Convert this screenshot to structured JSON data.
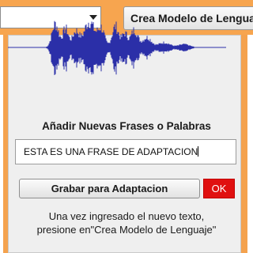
{
  "toolbar": {
    "combo_value": "",
    "build_model_label": "Crea Modelo de Lenguaje"
  },
  "panel": {
    "title": "Añadir Nuevas Frases o Palabras",
    "phrase_value": "ESTA ES UNA FRASE DE ADAPTACION",
    "record_label": "Grabar para Adaptacion",
    "ok_label": "OK",
    "hint_line1": "Una vez ingresado el nuevo texto,",
    "hint_line2": "presione en\"Crea Modelo de Lenguaje\""
  },
  "colors": {
    "accent_orange": "#f6a04a",
    "waveform": "#2b2fa8",
    "ok_red": "#e01010"
  },
  "icons": {
    "combo_arrow": "chevron-down-icon"
  }
}
